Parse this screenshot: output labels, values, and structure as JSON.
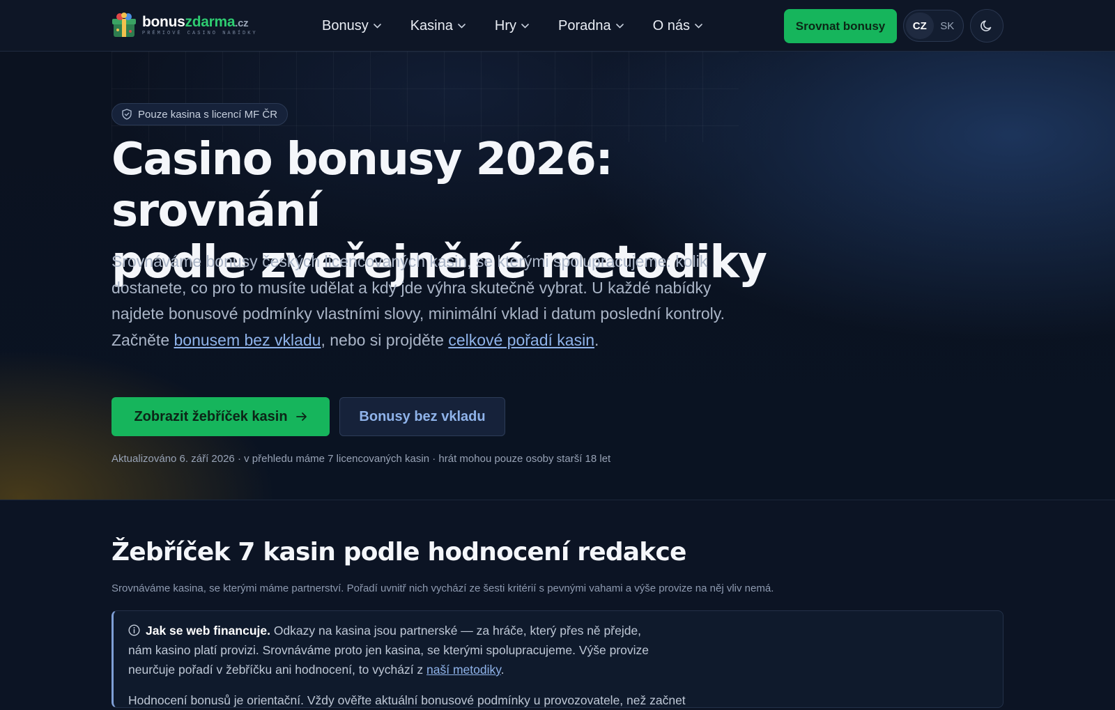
{
  "header": {
    "logo": {
      "word_1": "bonus",
      "word_2": "zdarma",
      "word_3": ".cz",
      "tagline": "PRÉMIOVÉ CASINO NABÍDKY",
      "accent_color": "#2ecc71"
    },
    "nav": [
      {
        "label": "Bonusy",
        "icon": "chevron-down-icon"
      },
      {
        "label": "Kasina",
        "icon": "chevron-down-icon"
      },
      {
        "label": "Hry",
        "icon": "chevron-down-icon"
      },
      {
        "label": "Poradna",
        "icon": "chevron-down-icon"
      },
      {
        "label": "O nás",
        "icon": "chevron-down-icon"
      }
    ],
    "compare_button": "Srovnat bonusy",
    "languages": [
      {
        "code": "CZ",
        "active": true
      },
      {
        "code": "SK",
        "active": false
      }
    ],
    "theme_icon": "moon-icon"
  },
  "hero": {
    "badge": {
      "icon": "shield-check-icon",
      "label": "Pouze kasina s licencí MF ČR"
    },
    "title_line_1": "Casino bonusy 2026: srovnání",
    "title_line_2": "podle zveřejněné metodiky",
    "lead": {
      "text_1": "Srovnáváme bonusy českých licencovaných kasin, se kterými spolupracujeme: kolik dostanete, co pro to musíte udělat a kdy jde výhra skutečně vybrat. U každé nabídky najdete bonusové podmínky vlastními slovy, minimální vklad i datum poslední kontroly. Začněte ",
      "link_1": "bonusem bez vkladu",
      "text_2": ", nebo si projděte ",
      "link_2": "celkové pořadí kasin",
      "text_3": "."
    },
    "primary_button": {
      "label": "Zobrazit žebříček kasin",
      "icon": "arrow-right-icon"
    },
    "secondary_button": "Bonusy bez vkladu",
    "meta": "Aktualizováno 6. září 2026 · v přehledu máme 7 licencovaných kasin · hrát mohou pouze osoby starší 18 let"
  },
  "ranking": {
    "title": "Žebříček 7 kasin podle hodnocení redakce",
    "subtitle": "Srovnáváme kasina, se kterými máme partnerství. Pořadí uvnitř nich vychází ze šesti kritérií s pevnými vahami a výše provize na něj vliv nemá.",
    "disclosure": {
      "icon": "info-icon",
      "heading": "Jak se web financuje.",
      "text": " Odkazy na kasina jsou partnerské — za hráče, který přes ně přejde, nám kasino platí provizi. Srovnáváme proto jen kasina, se kterými spolupracujeme. Výše provize neurčuje pořadí v žebříčku ani hodnocení, to vychází z ",
      "link": "naší metodiky",
      "text_end": ".",
      "next_line": "Hodnocení bonusů je orientační. Vždy ověřte aktuální bonusové podmínky u provozovatele, než začnete"
    }
  }
}
